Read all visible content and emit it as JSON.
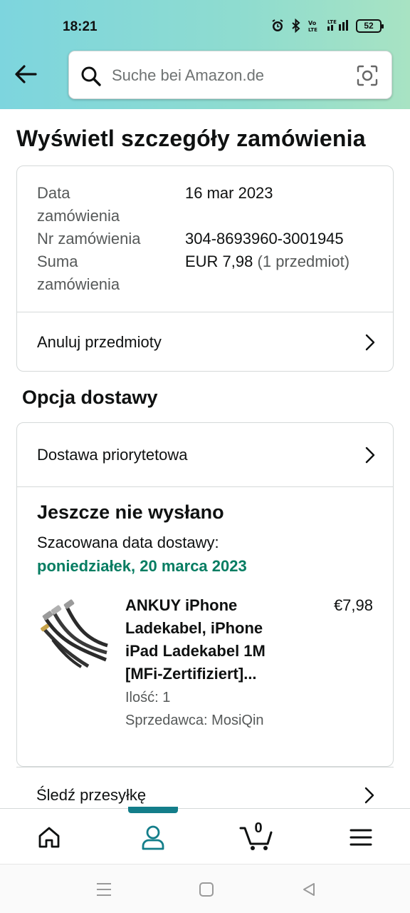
{
  "status_bar": {
    "time": "18:21",
    "battery": "52"
  },
  "search": {
    "placeholder": "Suche bei Amazon.de"
  },
  "page": {
    "title": "Wyświetl szczegóły zamówienia"
  },
  "order_summary": {
    "date_label_line1": "Data",
    "date_label_line2": "zamówienia",
    "date_value": "16 mar 2023",
    "number_label": "Nr zamówienia",
    "number_value": "304-8693960-3001945",
    "total_label_line1": "Suma",
    "total_label_line2": "zamówienia",
    "total_value": "EUR 7,98",
    "total_items": "(1 przedmiot)",
    "cancel_label": "Anuluj przedmioty"
  },
  "delivery": {
    "section_title": "Opcja dostawy",
    "option_label": "Dostawa priorytetowa",
    "status": "Jeszcze nie wysłano",
    "estimate_label": "Szacowana data dostawy:",
    "estimate_date": "poniedziałek, 20 marca 2023"
  },
  "product": {
    "title": "ANKUY iPhone Ladekabel, iPhone iPad Ladekabel 1M [MFi-Zertifiziert]...",
    "price": "€7,98",
    "quantity": "Ilość: 1",
    "seller": "Sprzedawca: MosiQin"
  },
  "track": {
    "label": "Śledź przesyłkę"
  },
  "bottom_nav": {
    "cart_count": "0",
    "active": "account"
  },
  "colors": {
    "accent": "#137e8a",
    "green": "#067d62",
    "header_start": "#7dd5de",
    "header_end": "#a8e3c3"
  }
}
